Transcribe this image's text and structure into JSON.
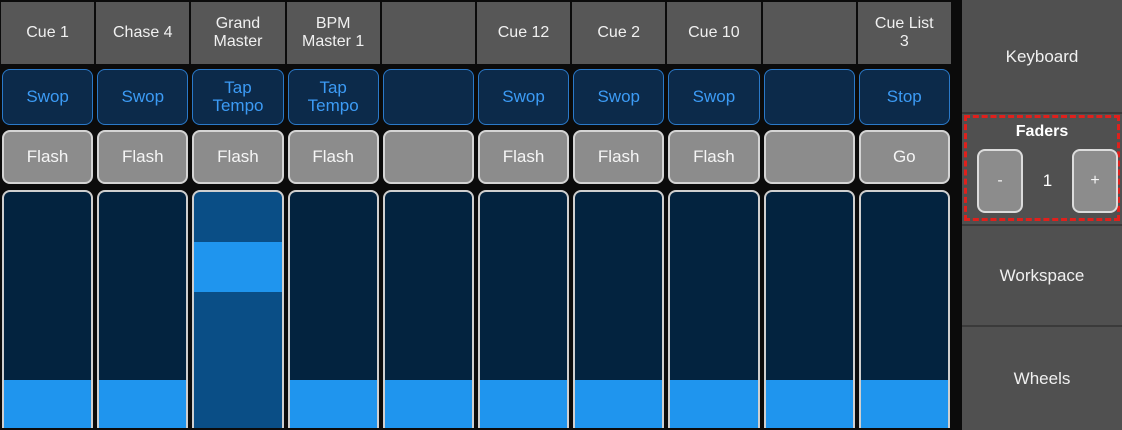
{
  "columns": [
    {
      "label": "Cue 1",
      "top_button": "Swop",
      "bottom_button": "Flash",
      "level": 0.2
    },
    {
      "label": "Chase 4",
      "top_button": "Swop",
      "bottom_button": "Flash",
      "level": 0.2
    },
    {
      "label": "Grand\nMaster",
      "top_button": "Tap\nTempo",
      "bottom_button": "Flash",
      "level": 0.79
    },
    {
      "label": "BPM\nMaster 1",
      "top_button": "Tap\nTempo",
      "bottom_button": "Flash",
      "level": 0.2
    },
    {
      "label": "",
      "top_button": "",
      "bottom_button": "",
      "level": 0.2
    },
    {
      "label": "Cue 12",
      "top_button": "Swop",
      "bottom_button": "Flash",
      "level": 0.2
    },
    {
      "label": "Cue 2",
      "top_button": "Swop",
      "bottom_button": "Flash",
      "level": 0.2
    },
    {
      "label": "Cue 10",
      "top_button": "Swop",
      "bottom_button": "Flash",
      "level": 0.2
    },
    {
      "label": "",
      "top_button": "",
      "bottom_button": "",
      "level": 0.2
    },
    {
      "label": "Cue List\n3",
      "top_button": "Stop",
      "bottom_button": "Go",
      "level": 0.2
    }
  ],
  "side": {
    "keyboard": "Keyboard",
    "faders_title": "Faders",
    "minus": "-",
    "page": "1",
    "plus": "+",
    "workspace": "Workspace",
    "wheels": "Wheels"
  },
  "colors": {
    "fader_fill": "#1f95ee",
    "fader_bg": "#03233f",
    "button_blue": "#3c9bf5",
    "highlight": "#e0201c"
  }
}
